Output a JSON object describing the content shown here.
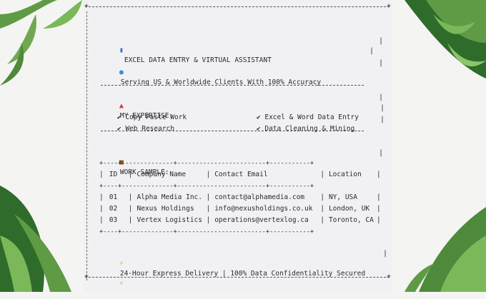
{
  "header": {
    "title": "EXCEL DATA ENTRY & VIRTUAL ASSISTANT",
    "subtitle": "Serving US & Worldwide Clients With 100% Accuracy"
  },
  "expertise": {
    "heading": "MY EXPERTISE:",
    "check": "✔",
    "items": [
      "Copy Paste Work",
      "Excel & Word Data Entry",
      "Web Research",
      "Data Cleaning & Mining"
    ]
  },
  "work_sample": {
    "heading": "WORK SAMPLE:",
    "table_border": "+----+--------------+------------------------+-----------+",
    "columns": [
      "ID",
      "Company Name",
      "Contact Email",
      "Location"
    ],
    "rows": [
      [
        "01",
        "Alpha Media Inc.",
        "contact@alphamedia.com",
        "NY, USA"
      ],
      [
        "02",
        "Nexus Holdings",
        "info@nexusholdings.co.uk",
        "London, UK"
      ],
      [
        "03",
        "Vertex Logistics",
        "operations@vertexlog.ca",
        "Toronto, CA"
      ]
    ]
  },
  "footer": {
    "text": "24-Hour Express Delivery | 100% Data Confidentiality Secured"
  },
  "icons": {
    "title": "bar-chart-icon",
    "subtitle": "globe-icon",
    "expertise": "pushpin-icon",
    "work": "briefcase-icon",
    "footer": "lightning-icon"
  },
  "colors": {
    "card": "#f1f1f4",
    "leaf": "#4e8a3b"
  }
}
